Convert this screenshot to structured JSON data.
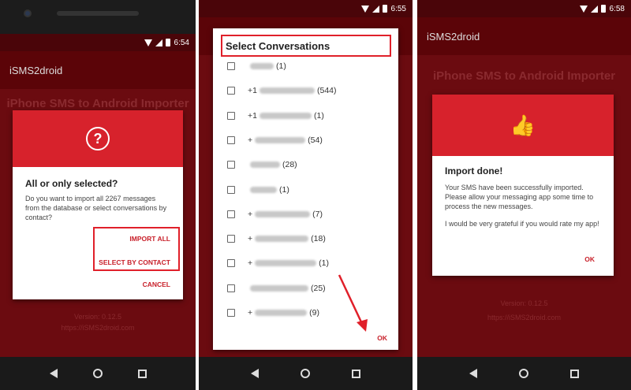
{
  "colors": {
    "accent": "#d7222c",
    "appbar": "#5b0408",
    "background": "#6b0b10",
    "highlight": "#e0202a"
  },
  "screen1": {
    "time": "6:54",
    "app_title": "iSMS2droid",
    "heading": "iPhone SMS to Android Importer",
    "dialog": {
      "icon": "question-icon",
      "icon_glyph": "?",
      "title": "All or only selected?",
      "text": "Do you want to import all 2267 messages from the database or select conversations by contact?",
      "import_all": "IMPORT ALL",
      "select_by_contact": "SELECT BY CONTACT",
      "cancel": "CANCEL"
    },
    "version": "Version: 0.12.5",
    "url": "https://iSMS2droid.com"
  },
  "screen2": {
    "time": "6:55",
    "dialog_title": "Select Conversations",
    "conversations": [
      {
        "prefix": "",
        "count": "(1)"
      },
      {
        "prefix": "+1",
        "count": "(544)"
      },
      {
        "prefix": "+1",
        "count": "(1)"
      },
      {
        "prefix": "+",
        "count": "(54)"
      },
      {
        "prefix": "",
        "count": "(28)"
      },
      {
        "prefix": "",
        "count": "(1)"
      },
      {
        "prefix": "+",
        "count": "(7)"
      },
      {
        "prefix": "+",
        "count": "(18)"
      },
      {
        "prefix": "+",
        "count": "(1)"
      },
      {
        "prefix": "",
        "count": "(25)"
      },
      {
        "prefix": "+",
        "count": "(9)"
      }
    ],
    "ok": "OK"
  },
  "screen3": {
    "time": "6:58",
    "app_title": "iSMS2droid",
    "heading": "iPhone SMS to Android Importer",
    "dialog": {
      "icon": "thumbs-up-icon",
      "icon_glyph": "👍",
      "title": "Import done!",
      "text1": "Your SMS have been successfully imported. Please allow your messaging app some time to process the new messages.",
      "text2": "I would be very grateful if you would rate my app!",
      "ok": "OK"
    },
    "version": "Version: 0.12.5",
    "url": "https://iSMS2droid.com"
  }
}
